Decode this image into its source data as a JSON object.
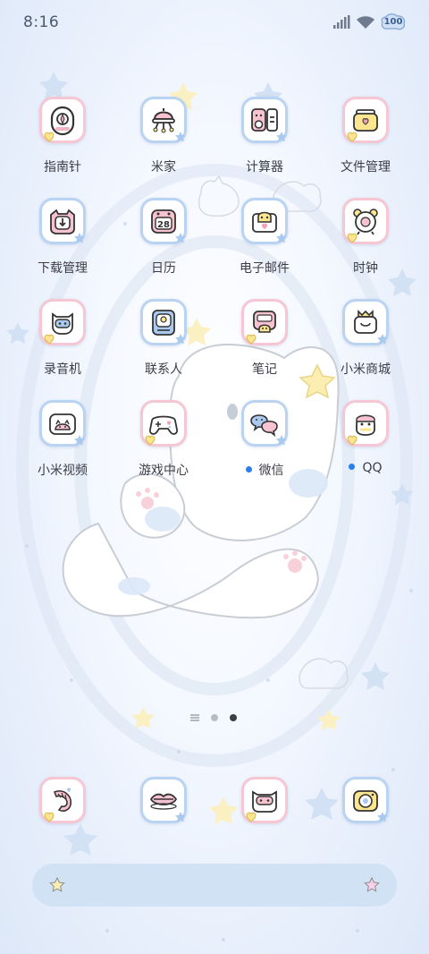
{
  "status_bar": {
    "time": "8:16",
    "battery_level": "100",
    "icons": [
      "signal-icon",
      "wifi-icon",
      "battery-icon"
    ]
  },
  "apps": [
    {
      "label": "指南针",
      "icon": "compass-icon",
      "frame": "pink",
      "new_dot": false
    },
    {
      "label": "米家",
      "icon": "mi-home-icon",
      "frame": "blue",
      "new_dot": false
    },
    {
      "label": "计算器",
      "icon": "calculator-icon",
      "frame": "blue",
      "new_dot": false
    },
    {
      "label": "文件管理",
      "icon": "file-manager-icon",
      "frame": "pink",
      "new_dot": false
    },
    {
      "label": "下载管理",
      "icon": "download-icon",
      "frame": "blue",
      "new_dot": false
    },
    {
      "label": "日历",
      "icon": "calendar-icon",
      "frame": "blue",
      "new_dot": false,
      "day": "28"
    },
    {
      "label": "电子邮件",
      "icon": "email-icon",
      "frame": "blue",
      "new_dot": false
    },
    {
      "label": "时钟",
      "icon": "clock-icon",
      "frame": "pink",
      "new_dot": false
    },
    {
      "label": "录音机",
      "icon": "recorder-icon",
      "frame": "pink",
      "new_dot": false
    },
    {
      "label": "联系人",
      "icon": "contacts-icon",
      "frame": "blue",
      "new_dot": false
    },
    {
      "label": "笔记",
      "icon": "notes-icon",
      "frame": "pink",
      "new_dot": false
    },
    {
      "label": "小米商城",
      "icon": "mi-store-icon",
      "frame": "blue",
      "new_dot": false
    },
    {
      "label": "小米视频",
      "icon": "mi-video-icon",
      "frame": "blue",
      "new_dot": false
    },
    {
      "label": "游戏中心",
      "icon": "game-center-icon",
      "frame": "pink",
      "new_dot": false
    },
    {
      "label": "微信",
      "icon": "wechat-icon",
      "frame": "blue",
      "new_dot": true
    },
    {
      "label": "QQ",
      "icon": "qq-icon",
      "frame": "pink",
      "new_dot": true
    }
  ],
  "page_indicator": {
    "pages": 3,
    "current": 3,
    "has_list_page": true
  },
  "dock": [
    {
      "icon": "shrimp-icon",
      "frame": "pink"
    },
    {
      "icon": "lips-icon",
      "frame": "blue"
    },
    {
      "icon": "video-call-icon",
      "frame": "pink"
    },
    {
      "icon": "camera-icon",
      "frame": "blue"
    }
  ],
  "search_bar": {
    "left_icon": "star-icon",
    "right_icon": "star-icon"
  },
  "colors": {
    "pink_frame": "#f6c6d3",
    "blue_frame": "#b9d4f2",
    "new_dot": "#2b7ef0",
    "search_bar": "#d2e2f5"
  }
}
